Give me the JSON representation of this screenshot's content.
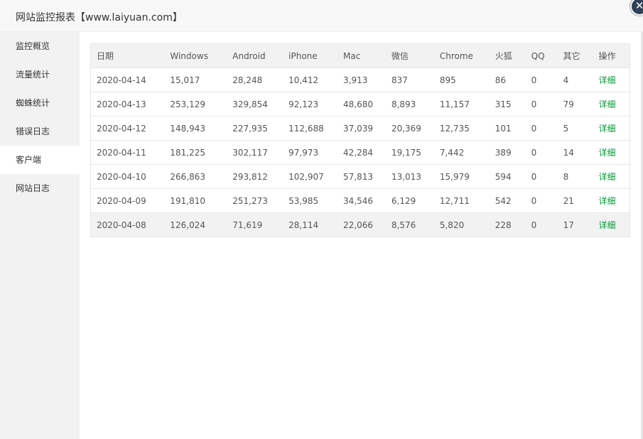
{
  "window": {
    "title": "网站监控报表【www.laiyuan.com】",
    "close_icon": "close-icon",
    "close_glyph": "✕"
  },
  "sidebar": {
    "items": [
      {
        "label": "监控概览",
        "active": false
      },
      {
        "label": "流量统计",
        "active": false
      },
      {
        "label": "蜘蛛统计",
        "active": false
      },
      {
        "label": "错误日志",
        "active": false
      },
      {
        "label": "客户端",
        "active": true
      },
      {
        "label": "网站日志",
        "active": false
      }
    ]
  },
  "table": {
    "headers": [
      "日期",
      "Windows",
      "Android",
      "iPhone",
      "Mac",
      "微信",
      "Chrome",
      "火狐",
      "QQ",
      "其它",
      "操作"
    ],
    "rows": [
      [
        "2020-04-14",
        "15,017",
        "28,248",
        "10,412",
        "3,913",
        "837",
        "895",
        "86",
        "0",
        "4",
        "详细"
      ],
      [
        "2020-04-13",
        "253,129",
        "329,854",
        "92,123",
        "48,680",
        "8,893",
        "11,157",
        "315",
        "0",
        "79",
        "详细"
      ],
      [
        "2020-04-12",
        "148,943",
        "227,935",
        "112,688",
        "37,039",
        "20,369",
        "12,735",
        "101",
        "0",
        "5",
        "详细"
      ],
      [
        "2020-04-11",
        "181,225",
        "302,117",
        "97,973",
        "42,284",
        "19,175",
        "7,442",
        "389",
        "0",
        "14",
        "详细"
      ],
      [
        "2020-04-10",
        "266,863",
        "293,812",
        "102,907",
        "57,813",
        "13,013",
        "15,979",
        "594",
        "0",
        "8",
        "详细"
      ],
      [
        "2020-04-09",
        "191,810",
        "251,273",
        "53,985",
        "34,546",
        "6,129",
        "12,711",
        "542",
        "0",
        "21",
        "详细"
      ],
      [
        "2020-04-08",
        "126,024",
        "71,619",
        "28,114",
        "22,066",
        "8,576",
        "5,820",
        "228",
        "0",
        "17",
        "详细"
      ]
    ]
  },
  "colors": {
    "link": "#009933",
    "sidebar_bg": "#f2f2f2",
    "header_bg": "#f2f2f2"
  }
}
